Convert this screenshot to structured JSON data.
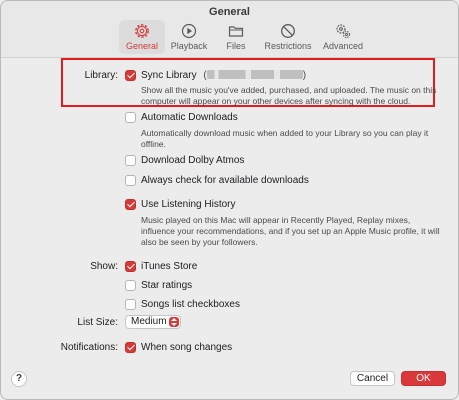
{
  "window": {
    "title": "General"
  },
  "toolbar": {
    "tabs": [
      {
        "label": "General",
        "icon": "gear-icon",
        "active": true
      },
      {
        "label": "Playback",
        "icon": "play-circle-icon",
        "active": false
      },
      {
        "label": "Files",
        "icon": "folder-icon",
        "active": false
      },
      {
        "label": "Restrictions",
        "icon": "restrictions-icon",
        "active": false
      },
      {
        "label": "Advanced",
        "icon": "gears-icon",
        "active": false
      }
    ]
  },
  "library": {
    "label": "Library:",
    "sync_label": "Sync Library",
    "sync_checked": true,
    "account": "(",
    "account_end": ")",
    "sync_desc": "Show all the music you've added, purchased, and uploaded. The music on this computer will appear on your other devices after syncing with the cloud."
  },
  "downloads": {
    "auto_label": "Automatic Downloads",
    "auto_checked": false,
    "auto_desc": "Automatically download music when added to your Library so you can play it offline.",
    "dolby_label": "Download Dolby Atmos",
    "dolby_checked": false,
    "always_label": "Always check for available downloads",
    "always_checked": false
  },
  "history": {
    "label": "Use Listening History",
    "checked": true,
    "desc": "Music played on this Mac will appear in Recently Played, Replay mixes, influence your recommendations, and if you set up an Apple Music profile, it will also be seen by your followers."
  },
  "show": {
    "label": "Show:",
    "itunes_label": "iTunes Store",
    "itunes_checked": true,
    "star_label": "Star ratings",
    "star_checked": false,
    "songs_label": "Songs list checkboxes",
    "songs_checked": false
  },
  "list_size": {
    "label": "List Size:",
    "value": "Medium"
  },
  "notifications": {
    "label": "Notifications:",
    "song_label": "When song changes",
    "song_checked": true
  },
  "footer": {
    "help": "?",
    "cancel": "Cancel",
    "ok": "OK"
  },
  "colors": {
    "accent": "#d9393a",
    "highlight_box": "#e21c1c"
  }
}
